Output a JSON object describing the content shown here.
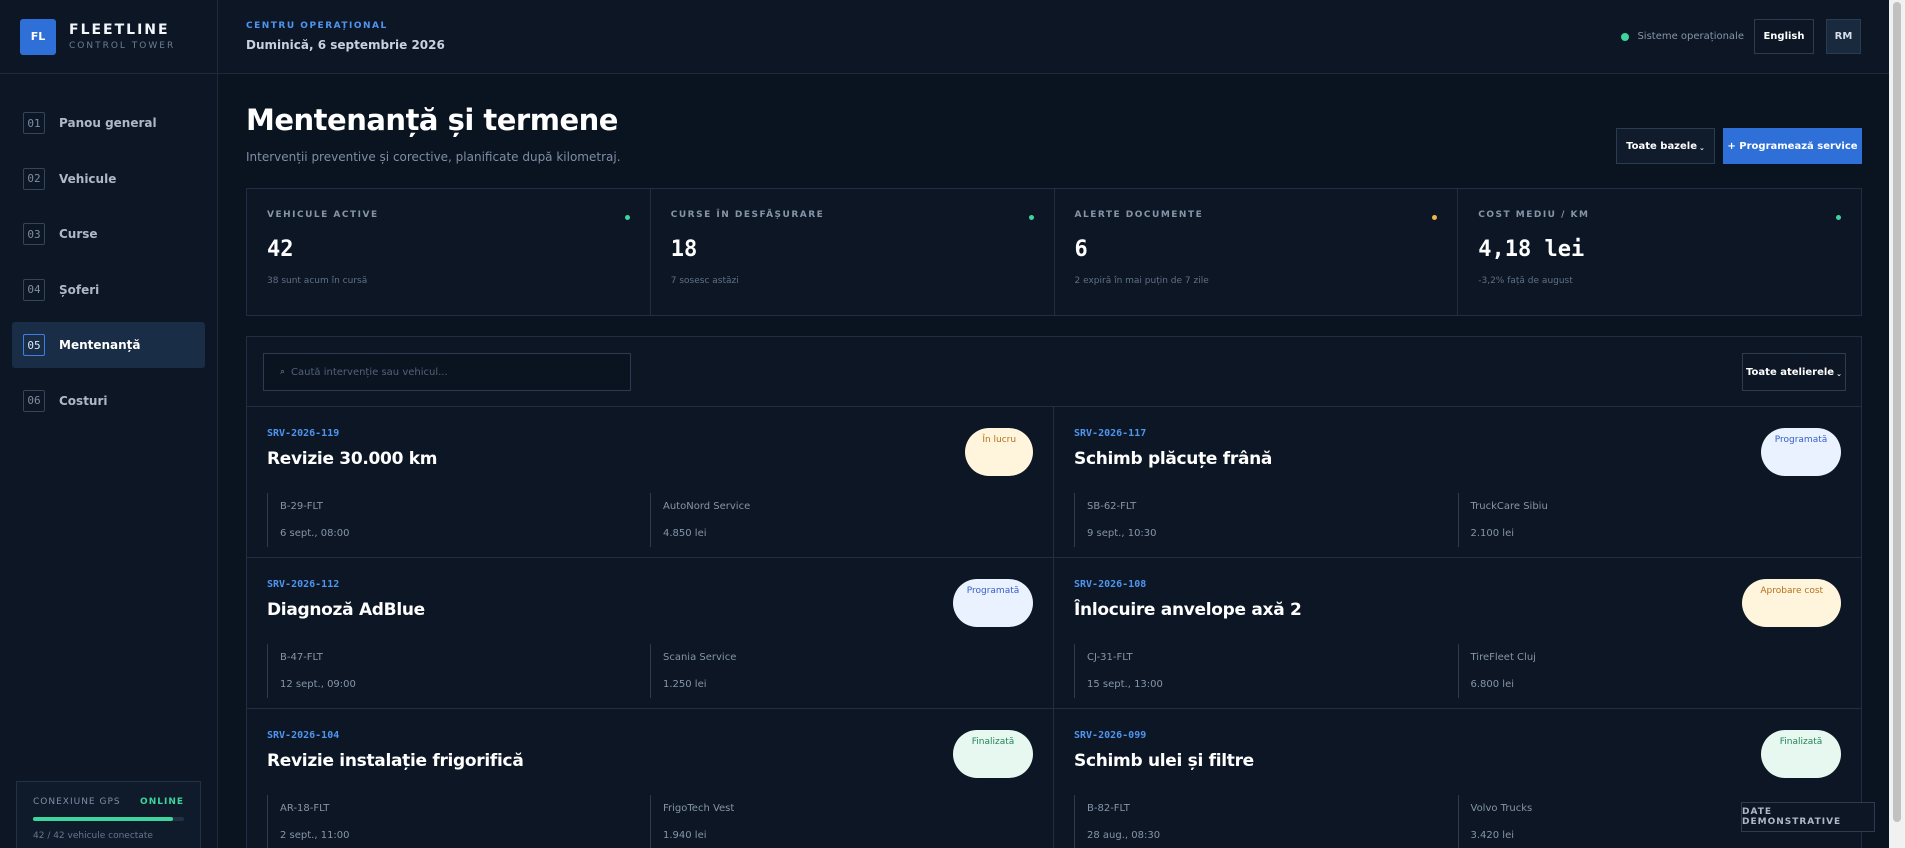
{
  "brand": {
    "logo": "FL",
    "name": "FLEETLINE",
    "subtitle": "CONTROL TOWER"
  },
  "sidebar": {
    "items": [
      {
        "num": "01",
        "label": "Panou general",
        "active": false
      },
      {
        "num": "02",
        "label": "Vehicule",
        "active": false
      },
      {
        "num": "03",
        "label": "Curse",
        "active": false
      },
      {
        "num": "04",
        "label": "Șoferi",
        "active": false
      },
      {
        "num": "05",
        "label": "Mentenanță",
        "active": true
      },
      {
        "num": "06",
        "label": "Costuri",
        "active": false
      }
    ],
    "gps": {
      "label": "CONEXIUNE GPS",
      "status": "ONLINE",
      "progress": 0.93,
      "sub": "42 / 42 vehicule conectate"
    }
  },
  "topbar": {
    "kicker": "CENTRU OPERAȚIONAL",
    "date": "Duminică, 6 septembrie 2026",
    "status": "Sisteme operaționale",
    "language": "English",
    "user_initials": "RM"
  },
  "header": {
    "title": "Mentenanță și termene",
    "subtitle": "Intervenții preventive și corective, planificate după kilometraj.",
    "filter_label": "Toate bazele",
    "primary_label": "+ Programează service"
  },
  "kpis": [
    {
      "label": "VEHICULE ACTIVE",
      "value": "42",
      "sub": "38 sunt acum în cursă",
      "dot_color": "#3ed59c"
    },
    {
      "label": "CURSE ÎN DESFĂȘURARE",
      "value": "18",
      "sub": "7 sosesc astăzi",
      "dot_color": "#3ed59c"
    },
    {
      "label": "ALERTE DOCUMENTE",
      "value": "6",
      "sub": "2 expiră în mai puțin de 7 zile",
      "dot_color": "#f0b64b"
    },
    {
      "label": "COST MEDIU / KM",
      "value": "4,18 lei",
      "sub": "-3,2% față de august",
      "dot_color": "#3ed59c"
    }
  ],
  "search": {
    "placeholder": "Caută intervenție sau vehicul..."
  },
  "workshop_filter": "Toate atelierele",
  "cards": [
    {
      "id": "SRV-2026-119",
      "title": "Revizie 30.000 km",
      "status": "În lucru",
      "status_bg": "#fff5dc",
      "status_color": "#b5701a",
      "plate": "B-29-FLT",
      "workshop": "AutoNord Service",
      "date": "6 sept., 08:00",
      "cost": "4.850 lei"
    },
    {
      "id": "SRV-2026-117",
      "title": "Schimb plăcuțe frână",
      "status": "Programată",
      "status_bg": "#eaf1ff",
      "status_color": "#3760c9",
      "plate": "SB-62-FLT",
      "workshop": "TruckCare Sibiu",
      "date": "9 sept., 10:30",
      "cost": "2.100 lei"
    },
    {
      "id": "SRV-2026-112",
      "title": "Diagnoză AdBlue",
      "status": "Programată",
      "status_bg": "#eaf1ff",
      "status_color": "#3760c9",
      "plate": "B-47-FLT",
      "workshop": "Scania Service",
      "date": "12 sept., 09:00",
      "cost": "1.250 lei"
    },
    {
      "id": "SRV-2026-108",
      "title": "Înlocuire anvelope axă 2",
      "status": "Aprobare cost",
      "status_bg": "#fff5dc",
      "status_color": "#b5701a",
      "plate": "CJ-31-FLT",
      "workshop": "TireFleet Cluj",
      "date": "15 sept., 13:00",
      "cost": "6.800 lei"
    },
    {
      "id": "SRV-2026-104",
      "title": "Revizie instalație frigorifică",
      "status": "Finalizată",
      "status_bg": "#e6f8ef",
      "status_color": "#23865a",
      "plate": "AR-18-FLT",
      "workshop": "FrigoTech Vest",
      "date": "2 sept., 11:00",
      "cost": "1.940 lei"
    },
    {
      "id": "SRV-2026-099",
      "title": "Schimb ulei și filtre",
      "status": "Finalizată",
      "status_bg": "#e6f8ef",
      "status_color": "#23865a",
      "plate": "B-82-FLT",
      "workshop": "Volvo Trucks",
      "date": "28 aug., 08:30",
      "cost": "3.420 lei"
    }
  ],
  "demo_tag": "DATE DEMONSTRATIVE"
}
